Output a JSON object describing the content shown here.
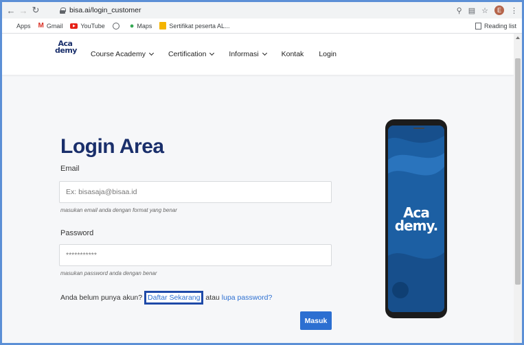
{
  "browser": {
    "url": "bisa.ai/login_customer",
    "avatar_letter": "E",
    "bookmarks": [
      {
        "label": "Apps",
        "icon": "apps-grid-icon"
      },
      {
        "label": "Gmail",
        "icon": "gmail-icon"
      },
      {
        "label": "YouTube",
        "icon": "youtube-icon"
      },
      {
        "label": "",
        "icon": "globe-icon"
      },
      {
        "label": "Maps",
        "icon": "maps-pin-icon"
      },
      {
        "label": "Sertifikat peserta AL...",
        "icon": "slides-icon"
      }
    ],
    "reading_list": "Reading list"
  },
  "site": {
    "logo_line1": "Aca",
    "logo_line2": "demy",
    "menu": [
      {
        "label": "Course Academy",
        "dropdown": true
      },
      {
        "label": "Certification",
        "dropdown": true
      },
      {
        "label": "Informasi",
        "dropdown": true
      },
      {
        "label": "Kontak",
        "dropdown": false
      },
      {
        "label": "Login",
        "dropdown": false
      }
    ]
  },
  "login": {
    "title": "Login Area",
    "email_label": "Email",
    "email_placeholder": "Ex: bisasaja@bisaa.id",
    "email_hint": "masukan email anda dengan format yang benar",
    "password_label": "Password",
    "password_value": "***********",
    "password_hint": "masukan password anda dengan benar",
    "register_prefix": "Anda belum punya akun?",
    "register_link": "Daftar Sekarang",
    "register_middle": "atau",
    "forgot_link": "lupa password?",
    "submit_label": "Masuk"
  },
  "phone": {
    "logo_line1": "Aca",
    "logo_line2": "demy."
  },
  "colors": {
    "brand_navy": "#1a2f6b",
    "link_blue": "#2c6fd1",
    "button_blue": "#2c6fd1",
    "frame_blue": "#5b8fd6",
    "phone_screen": "#1c5fa3"
  }
}
